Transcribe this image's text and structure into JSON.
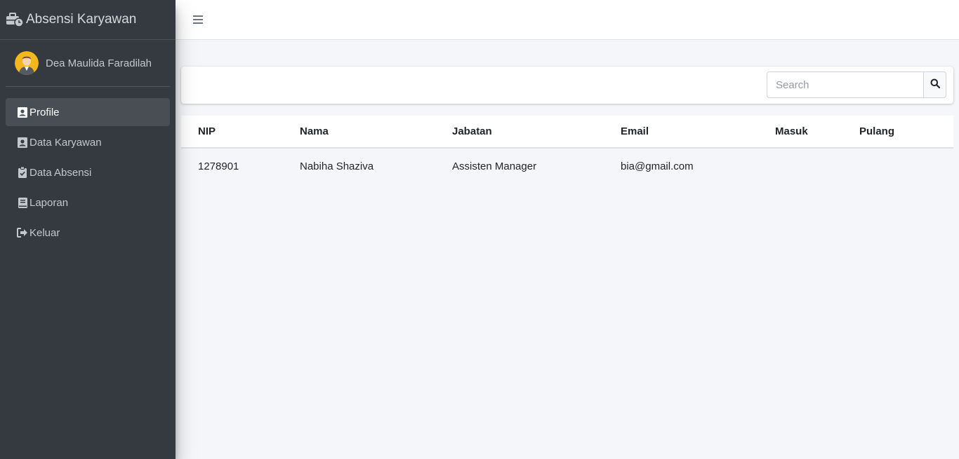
{
  "app": {
    "brand": "Absensi Karyawan"
  },
  "user": {
    "name": "Dea Maulida Faradilah"
  },
  "sidebar": {
    "items": [
      {
        "label": "Profile",
        "icon": "contact-card-icon",
        "active": true
      },
      {
        "label": "Data Karyawan",
        "icon": "contact-card-icon",
        "active": false
      },
      {
        "label": "Data Absensi",
        "icon": "clipboard-check-icon",
        "active": false
      },
      {
        "label": "Laporan",
        "icon": "book-icon",
        "active": false
      },
      {
        "label": "Keluar",
        "icon": "sign-out-icon",
        "active": false
      }
    ]
  },
  "search": {
    "placeholder": "Search",
    "value": ""
  },
  "table": {
    "headers": [
      "NIP",
      "Nama",
      "Jabatan",
      "Email",
      "Masuk",
      "Pulang"
    ],
    "rows": [
      [
        "1278901",
        "Nabiha Shaziva",
        "Assisten Manager",
        "bia@gmail.com",
        "",
        ""
      ]
    ]
  },
  "colors": {
    "sidebar_bg": "#343a40",
    "sidebar_text": "#c2c7d0",
    "content_bg": "#f4f6f9",
    "active_item_bg": "rgba(255,255,255,0.1)"
  }
}
